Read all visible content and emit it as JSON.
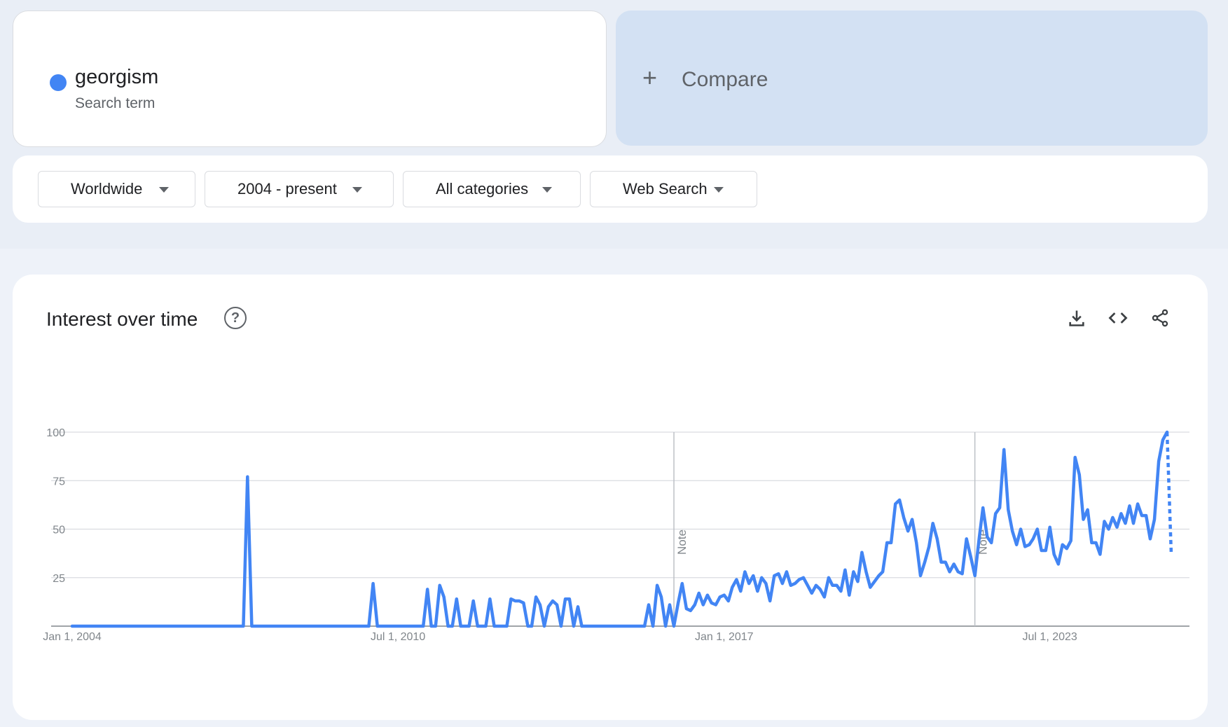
{
  "search_term": {
    "name": "georgism",
    "subtitle": "Search term",
    "color": "#4285f4"
  },
  "compare": {
    "plus": "+",
    "label": "Compare"
  },
  "filters": {
    "region": "Worldwide",
    "time_range": "2004 - present",
    "category": "All categories",
    "search_type": "Web Search"
  },
  "chart": {
    "title": "Interest over time",
    "help_glyph": "?",
    "note_label": "Note",
    "actions": [
      "download-icon",
      "embed-code-icon",
      "share-icon"
    ]
  },
  "chart_data": {
    "type": "line",
    "title": "Interest over time",
    "xlabel": "",
    "ylabel": "",
    "ylim": [
      0,
      100
    ],
    "y_ticks": [
      25,
      50,
      75,
      100
    ],
    "x_tick_labels": [
      "Jan 1, 2004",
      "Jul 1, 2010",
      "Jan 1, 2017",
      "Jul 1, 2023"
    ],
    "x_range": [
      "Jan 1, 2004",
      "Jan 1, 2026"
    ],
    "grid": true,
    "legend": "none",
    "line_color": "#4285f4",
    "notes": [
      {
        "date": "Jan 1, 2016",
        "label": "Note"
      },
      {
        "date": "Jan 1, 2022",
        "label": "Note"
      }
    ],
    "series": [
      {
        "name": "georgism",
        "dashed_tail_from": "Dec 1, 2025",
        "points": [
          [
            "Jan 1, 2004",
            0
          ],
          [
            "Jun 1, 2007",
            0
          ],
          [
            "Jul 1, 2007",
            77
          ],
          [
            "Aug 1, 2007",
            0
          ],
          [
            "Dec 1, 2009",
            0
          ],
          [
            "Jan 1, 2010",
            22
          ],
          [
            "Feb 1, 2010",
            0
          ],
          [
            "Jan 1, 2011",
            0
          ],
          [
            "Feb 1, 2011",
            19
          ],
          [
            "Mar 1, 2011",
            0
          ],
          [
            "Apr 1, 2011",
            0
          ],
          [
            "May 1, 2011",
            21
          ],
          [
            "Jun 1, 2011",
            15
          ],
          [
            "Jul 1, 2011",
            0
          ],
          [
            "Aug 1, 2011",
            0
          ],
          [
            "Sep 1, 2011",
            14
          ],
          [
            "Oct 1, 2011",
            0
          ],
          [
            "Nov 1, 2011",
            0
          ],
          [
            "Dec 1, 2011",
            0
          ],
          [
            "Jan 1, 2012",
            13
          ],
          [
            "Feb 1, 2012",
            0
          ],
          [
            "Mar 1, 2012",
            0
          ],
          [
            "Apr 1, 2012",
            0
          ],
          [
            "May 1, 2012",
            14
          ],
          [
            "Jun 1, 2012",
            0
          ],
          [
            "Jul 1, 2012",
            0
          ],
          [
            "Aug 1, 2012",
            0
          ],
          [
            "Sep 1, 2012",
            0
          ],
          [
            "Oct 1, 2012",
            14
          ],
          [
            "Nov 1, 2012",
            13
          ],
          [
            "Dec 1, 2012",
            13
          ],
          [
            "Jan 1, 2013",
            12
          ],
          [
            "Feb 1, 2013",
            0
          ],
          [
            "Mar 1, 2013",
            0
          ],
          [
            "Apr 1, 2013",
            15
          ],
          [
            "May 1, 2013",
            11
          ],
          [
            "Jun 1, 2013",
            0
          ],
          [
            "Jul 1, 2013",
            10
          ],
          [
            "Aug 1, 2013",
            13
          ],
          [
            "Sep 1, 2013",
            11
          ],
          [
            "Oct 1, 2013",
            0
          ],
          [
            "Nov 1, 2013",
            14
          ],
          [
            "Dec 1, 2013",
            14
          ],
          [
            "Jan 1, 2014",
            0
          ],
          [
            "Feb 1, 2014",
            10
          ],
          [
            "Mar 1, 2014",
            0
          ],
          [
            "Apr 1, 2014",
            0
          ],
          [
            "Jun 1, 2015",
            0
          ],
          [
            "Jul 1, 2015",
            11
          ],
          [
            "Aug 1, 2015",
            0
          ],
          [
            "Sep 1, 2015",
            21
          ],
          [
            "Oct 1, 2015",
            15
          ],
          [
            "Nov 1, 2015",
            0
          ],
          [
            "Dec 1, 2015",
            11
          ],
          [
            "Jan 1, 2016",
            0
          ],
          [
            "Feb 1, 2016",
            12
          ],
          [
            "Mar 1, 2016",
            22
          ],
          [
            "Apr 1, 2016",
            9
          ],
          [
            "May 1, 2016",
            8
          ],
          [
            "Jun 1, 2016",
            11
          ],
          [
            "Jul 1, 2016",
            17
          ],
          [
            "Aug 1, 2016",
            11
          ],
          [
            "Sep 1, 2016",
            16
          ],
          [
            "Oct 1, 2016",
            12
          ],
          [
            "Nov 1, 2016",
            11
          ],
          [
            "Dec 1, 2016",
            15
          ],
          [
            "Jan 1, 2017",
            16
          ],
          [
            "Feb 1, 2017",
            13
          ],
          [
            "Mar 1, 2017",
            20
          ],
          [
            "Apr 1, 2017",
            24
          ],
          [
            "May 1, 2017",
            18
          ],
          [
            "Jun 1, 2017",
            28
          ],
          [
            "Jul 1, 2017",
            22
          ],
          [
            "Aug 1, 2017",
            26
          ],
          [
            "Sep 1, 2017",
            18
          ],
          [
            "Oct 1, 2017",
            25
          ],
          [
            "Nov 1, 2017",
            22
          ],
          [
            "Dec 1, 2017",
            13
          ],
          [
            "Jan 1, 2018",
            26
          ],
          [
            "Feb 1, 2018",
            27
          ],
          [
            "Mar 1, 2018",
            22
          ],
          [
            "Apr 1, 2018",
            28
          ],
          [
            "May 1, 2018",
            21
          ],
          [
            "Jun 1, 2018",
            22
          ],
          [
            "Jul 1, 2018",
            24
          ],
          [
            "Aug 1, 2018",
            25
          ],
          [
            "Sep 1, 2018",
            21
          ],
          [
            "Oct 1, 2018",
            17
          ],
          [
            "Nov 1, 2018",
            21
          ],
          [
            "Dec 1, 2018",
            19
          ],
          [
            "Jan 1, 2019",
            15
          ],
          [
            "Feb 1, 2019",
            25
          ],
          [
            "Mar 1, 2019",
            21
          ],
          [
            "Apr 1, 2019",
            21
          ],
          [
            "May 1, 2019",
            18
          ],
          [
            "Jun 1, 2019",
            29
          ],
          [
            "Jul 1, 2019",
            16
          ],
          [
            "Aug 1, 2019",
            28
          ],
          [
            "Sep 1, 2019",
            23
          ],
          [
            "Oct 1, 2019",
            38
          ],
          [
            "Nov 1, 2019",
            28
          ],
          [
            "Dec 1, 2019",
            20
          ],
          [
            "Jan 1, 2020",
            23
          ],
          [
            "Feb 1, 2020",
            26
          ],
          [
            "Mar 1, 2020",
            28
          ],
          [
            "Apr 1, 2020",
            43
          ],
          [
            "May 1, 2020",
            43
          ],
          [
            "Jun 1, 2020",
            63
          ],
          [
            "Jul 1, 2020",
            65
          ],
          [
            "Aug 1, 2020",
            56
          ],
          [
            "Sep 1, 2020",
            49
          ],
          [
            "Oct 1, 2020",
            55
          ],
          [
            "Nov 1, 2020",
            43
          ],
          [
            "Dec 1, 2020",
            26
          ],
          [
            "Jan 1, 2021",
            33
          ],
          [
            "Feb 1, 2021",
            41
          ],
          [
            "Mar 1, 2021",
            53
          ],
          [
            "Apr 1, 2021",
            45
          ],
          [
            "May 1, 2021",
            33
          ],
          [
            "Jun 1, 2021",
            33
          ],
          [
            "Jul 1, 2021",
            28
          ],
          [
            "Aug 1, 2021",
            32
          ],
          [
            "Sep 1, 2021",
            28
          ],
          [
            "Oct 1, 2021",
            27
          ],
          [
            "Nov 1, 2021",
            45
          ],
          [
            "Dec 1, 2021",
            36
          ],
          [
            "Jan 1, 2022",
            26
          ],
          [
            "Feb 1, 2022",
            45
          ],
          [
            "Mar 1, 2022",
            61
          ],
          [
            "Apr 1, 2022",
            46
          ],
          [
            "May 1, 2022",
            43
          ],
          [
            "Jun 1, 2022",
            58
          ],
          [
            "Jul 1, 2022",
            61
          ],
          [
            "Aug 1, 2022",
            91
          ],
          [
            "Sep 1, 2022",
            60
          ],
          [
            "Oct 1, 2022",
            49
          ],
          [
            "Nov 1, 2022",
            42
          ],
          [
            "Dec 1, 2022",
            50
          ],
          [
            "Jan 1, 2023",
            41
          ],
          [
            "Feb 1, 2023",
            42
          ],
          [
            "Mar 1, 2023",
            45
          ],
          [
            "Apr 1, 2023",
            50
          ],
          [
            "May 1, 2023",
            39
          ],
          [
            "Jun 1, 2023",
            39
          ],
          [
            "Jul 1, 2023",
            51
          ],
          [
            "Aug 1, 2023",
            37
          ],
          [
            "Sep 1, 2023",
            32
          ],
          [
            "Oct 1, 2023",
            42
          ],
          [
            "Nov 1, 2023",
            40
          ],
          [
            "Dec 1, 2023",
            44
          ],
          [
            "Jan 1, 2024",
            87
          ],
          [
            "Feb 1, 2024",
            78
          ],
          [
            "Mar 1, 2024",
            55
          ],
          [
            "Apr 1, 2024",
            60
          ],
          [
            "May 1, 2024",
            43
          ],
          [
            "Jun 1, 2024",
            43
          ],
          [
            "Jul 1, 2024",
            37
          ],
          [
            "Aug 1, 2024",
            54
          ],
          [
            "Sep 1, 2024",
            50
          ],
          [
            "Oct 1, 2024",
            56
          ],
          [
            "Nov 1, 2024",
            51
          ],
          [
            "Dec 1, 2024",
            58
          ],
          [
            "Jan 1, 2025",
            53
          ],
          [
            "Feb 1, 2025",
            62
          ],
          [
            "Mar 1, 2025",
            53
          ],
          [
            "Apr 1, 2025",
            63
          ],
          [
            "May 1, 2025",
            57
          ],
          [
            "Jun 1, 2025",
            57
          ],
          [
            "Jul 1, 2025",
            45
          ],
          [
            "Aug 1, 2025",
            55
          ],
          [
            "Sep 1, 2025",
            85
          ],
          [
            "Oct 1, 2025",
            96
          ],
          [
            "Nov 1, 2025",
            100
          ],
          [
            "Dec 1, 2025",
            38
          ]
        ]
      }
    ]
  }
}
